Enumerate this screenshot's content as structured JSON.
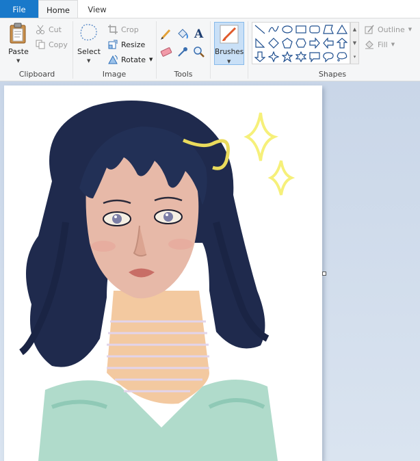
{
  "tabs": {
    "file": "File",
    "home": "Home",
    "view": "View"
  },
  "clipboard": {
    "paste": "Paste",
    "cut": "Cut",
    "copy": "Copy",
    "group_label": "Clipboard"
  },
  "image": {
    "select": "Select",
    "crop": "Crop",
    "resize": "Resize",
    "rotate": "Rotate",
    "group_label": "Image"
  },
  "tools": {
    "group_label": "Tools"
  },
  "brushes": {
    "label": "Brushes"
  },
  "shapes": {
    "group_label": "Shapes",
    "outline": "Outline",
    "fill": "Fill"
  },
  "colors": {
    "accent": "#1979ca",
    "ribbon_bg": "#f5f6f7",
    "workspace": "#c9d6e8",
    "hair": "#1f2a4d",
    "sparkle": "#f6f07a",
    "sweater": "#9fd3c0"
  }
}
